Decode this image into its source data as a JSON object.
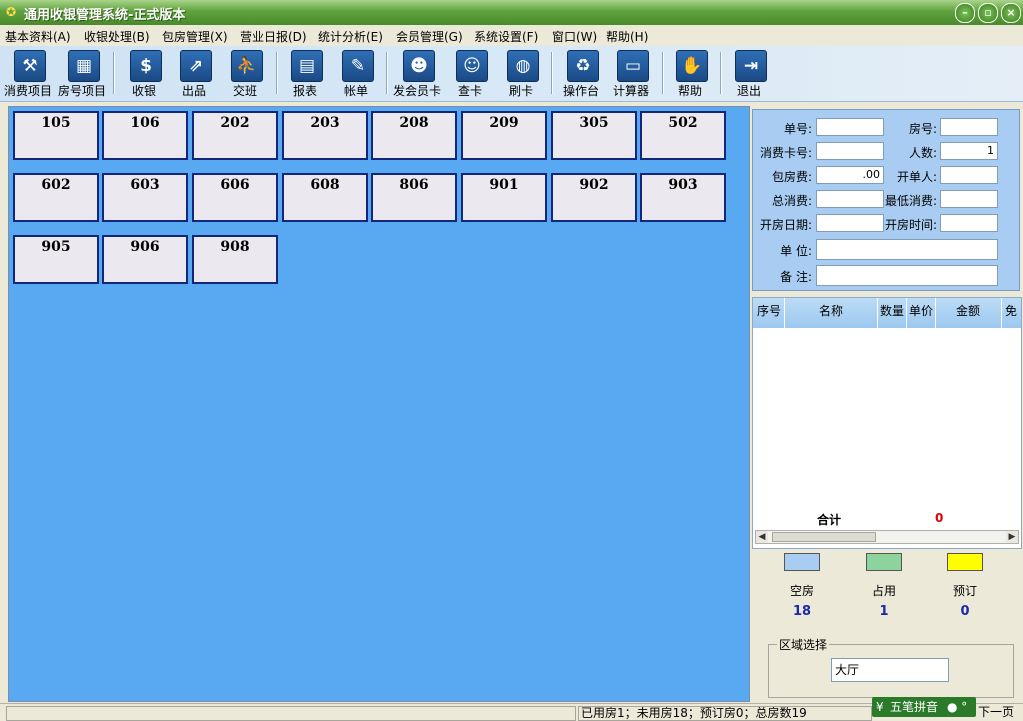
{
  "window": {
    "title": "通用收银管理系统-正式版本",
    "minimize": "–",
    "restore": "▫",
    "close": "×"
  },
  "menu": [
    "基本资料(A)",
    "收银处理(B)",
    "包房管理(X)",
    "营业日报(D)",
    "统计分析(E)",
    "会员管理(G)",
    "系统设置(F)",
    "窗口(W)",
    "帮助(H)"
  ],
  "toolbar": [
    {
      "label": "消费项目",
      "icon": "tools-icon",
      "glyph": "⚒"
    },
    {
      "label": "房号项目",
      "icon": "grid-icon",
      "glyph": "▦"
    },
    {
      "label": "收银",
      "icon": "dollar-icon",
      "glyph": "$"
    },
    {
      "label": "出品",
      "icon": "box-out-icon",
      "glyph": "⇗"
    },
    {
      "label": "交班",
      "icon": "people-icon",
      "glyph": "⛹"
    },
    {
      "label": "报表",
      "icon": "report-icon",
      "glyph": "▤"
    },
    {
      "label": "帐单",
      "icon": "bill-icon",
      "glyph": "✎"
    },
    {
      "label": "发会员卡",
      "icon": "members-icon",
      "glyph": "☻"
    },
    {
      "label": "查卡",
      "icon": "user-card-icon",
      "glyph": "☺"
    },
    {
      "label": "刷卡",
      "icon": "globe-icon",
      "glyph": "◍"
    },
    {
      "label": "操作台",
      "icon": "recycle-icon",
      "glyph": "♻"
    },
    {
      "label": "计算器",
      "icon": "calculator-icon",
      "glyph": "▭"
    },
    {
      "label": "帮助",
      "icon": "hand-icon",
      "glyph": "✋"
    },
    {
      "label": "退出",
      "icon": "exit-icon",
      "glyph": "⇥"
    }
  ],
  "rooms": [
    "105",
    "106",
    "202",
    "203",
    "208",
    "209",
    "305",
    "502",
    "602",
    "603",
    "606",
    "608",
    "806",
    "901",
    "902",
    "903",
    "905",
    "906",
    "908"
  ],
  "form": {
    "order_no": "单号:",
    "room_no": "房号:",
    "card_no": "消费卡号:",
    "guests": "人数:",
    "guests_value": "1",
    "room_fee": "包房费:",
    "room_fee_value": ".00",
    "opener": "开单人:",
    "total_spend": "总消费:",
    "min_spend": "最低消费:",
    "open_date": "开房日期:",
    "open_time": "开房时间:",
    "unit": "单 位:",
    "remark": "备 注:"
  },
  "grid": {
    "columns": [
      "序号",
      "名称",
      "数量",
      "单价",
      "金额",
      "免"
    ],
    "total_label": "合计",
    "total_value": "0"
  },
  "legend": [
    {
      "label": "空房",
      "count": "18",
      "color": "#a9cdf2"
    },
    {
      "label": "占用",
      "count": "1",
      "color": "#8dd39e"
    },
    {
      "label": "预订",
      "count": "0",
      "color": "#ffff00"
    }
  ],
  "zone": {
    "caption": "区域选择",
    "value": "大厅"
  },
  "status": {
    "summary": "已用房1；未用房18；预订房0；总房数19",
    "next_page": "下一页"
  },
  "ime": {
    "label": "五笔拼音"
  }
}
